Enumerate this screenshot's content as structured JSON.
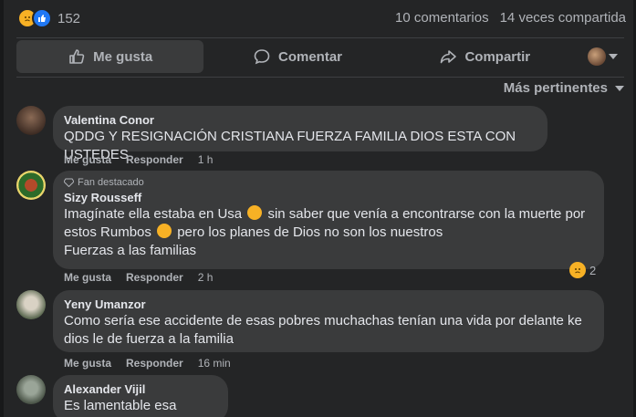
{
  "stats": {
    "reaction_count": "152",
    "comments": "10 comentarios",
    "shares": "14 veces compartida"
  },
  "actions": {
    "like": "Me gusta",
    "comment": "Comentar",
    "share": "Compartir"
  },
  "sort_label": "Más pertinentes",
  "comments": [
    {
      "author": "Valentina Conor",
      "text": "QDDG Y RESIGNACIÓN CRISTIANA FUERZA FAMILIA DIOS ESTA CON USTEDES",
      "like": "Me gusta",
      "reply": "Responder",
      "time": "1 h"
    },
    {
      "badge": "Fan destacado",
      "author": "Sizy Rousseff",
      "line1a": "Imagínate ella estaba en Usa",
      "line1b": "sin saber que venía a encontrarse con la muerte por",
      "line2a": "estos Rumbos",
      "line2b": "pero los planes de Dios no son los nuestros",
      "line3": "Fuerzas a las familias",
      "like": "Me gusta",
      "reply": "Responder",
      "time": "2 h",
      "reactions": "2"
    },
    {
      "author": "Yeny Umanzor",
      "line1": "Como sería ese accidente de esas pobres muchachas tenían una vida por delante ke",
      "line2": "dios le de fuerza a la familia",
      "like": "Me gusta",
      "reply": "Responder",
      "time": "16 min"
    },
    {
      "author": "Alexander Vijil",
      "text": "Es lamentable esa trajedia"
    }
  ]
}
